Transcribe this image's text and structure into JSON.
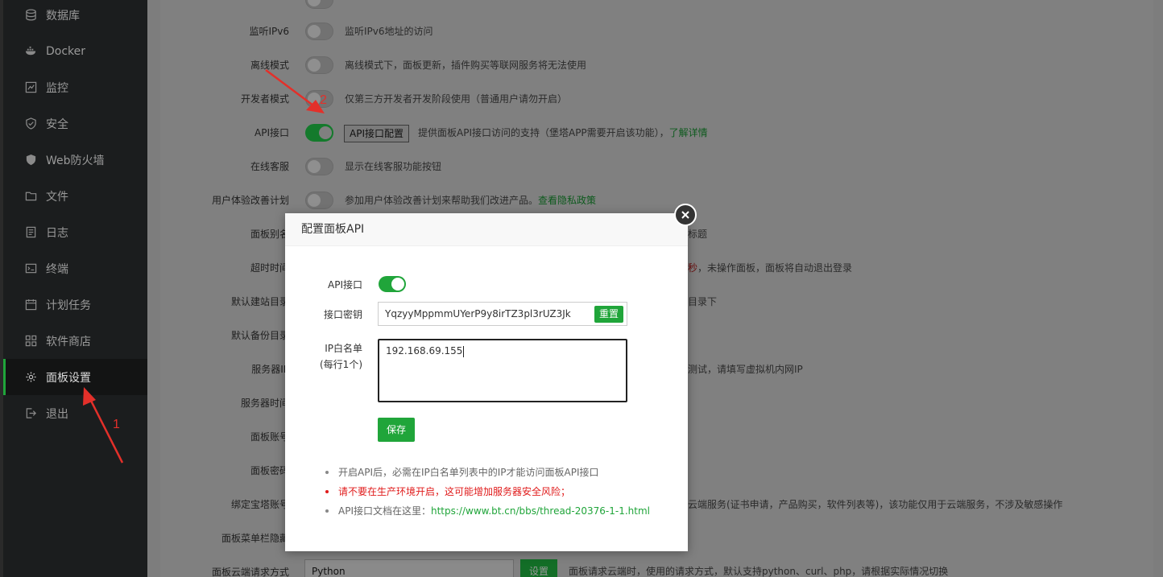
{
  "sidebar": {
    "items": [
      {
        "label": "数据库",
        "icon": "database-icon"
      },
      {
        "label": "Docker",
        "icon": "docker-icon"
      },
      {
        "label": "监控",
        "icon": "monitor-icon"
      },
      {
        "label": "安全",
        "icon": "shield-icon"
      },
      {
        "label": "Web防火墙",
        "icon": "firewall-icon"
      },
      {
        "label": "文件",
        "icon": "folder-icon"
      },
      {
        "label": "日志",
        "icon": "log-icon"
      },
      {
        "label": "终端",
        "icon": "terminal-icon"
      },
      {
        "label": "计划任务",
        "icon": "calendar-icon"
      },
      {
        "label": "软件商店",
        "icon": "grid-icon"
      },
      {
        "label": "面板设置",
        "icon": "gear-icon",
        "active": true
      },
      {
        "label": "退出",
        "icon": "logout-icon"
      }
    ]
  },
  "settings": {
    "ipv6": {
      "label": "监听IPv6",
      "desc": "监听IPv6地址的访问",
      "on": false
    },
    "offline": {
      "label": "离线模式",
      "desc": "离线模式下，面板更新，插件购买等联网服务将无法使用",
      "on": false
    },
    "dev": {
      "label": "开发者模式",
      "desc": "仅第三方开发者开发阶段使用（普通用户请勿开启）",
      "on": false
    },
    "api": {
      "label": "API接口",
      "button": "API接口配置",
      "desc": "提供面板API接口访问的支持（堡塔APP需要开启该功能），",
      "link": "了解详情",
      "on": true
    },
    "service": {
      "label": "在线客服",
      "desc": "显示在线客服功能按钮",
      "on": false
    },
    "ux": {
      "label": "用户体验改善计划",
      "desc": "参加用户体验改善计划来帮助我们改进产品。",
      "link": "查看隐私政策",
      "on": false
    },
    "alias": {
      "label": "面板别名",
      "tail": "标题"
    },
    "timeout": {
      "label": "超时时间",
      "tail_red": "秒",
      "tail": "，未操作面板，面板将自动退出登录"
    },
    "site_dir": {
      "label": "默认建站目录",
      "tail": "目录下"
    },
    "backup_dir": {
      "label": "默认备份目录"
    },
    "server_ip": {
      "label": "服务器IP",
      "tail": "测试，请填写虚拟机内网IP"
    },
    "server_time": {
      "label": "服务器时间"
    },
    "account": {
      "label": "面板账号"
    },
    "password": {
      "label": "面板密码"
    },
    "bind": {
      "label": "绑定宝塔账号",
      "tail": "云端服务(证书申请，产品购买，软件列表等)，该功能仅用于云端服务，不涉及敏感操作"
    },
    "menu_hide": {
      "label": "面板菜单栏隐藏"
    },
    "cloud": {
      "label": "面板云端请求方式",
      "value": "Python",
      "button": "设置",
      "desc": "面板请求云端时，使用的请求方式，默认支持python、curl、php，请根据实际情况切换"
    }
  },
  "annotations": {
    "one": "1",
    "two": "2"
  },
  "dialog": {
    "title": "配置面板API",
    "api_label": "API接口",
    "key_label": "接口密钥",
    "key_value": "YqzyyMppmmUYerP9y8irTZ3pl3rUZ3Jk",
    "reset": "重置",
    "ip_label_1": "IP白名单",
    "ip_label_2": "(每行1个)",
    "ip_value": "192.168.69.155",
    "save": "保存",
    "note1": "开启API后，必需在IP白名单列表中的IP才能访问面板API接口",
    "note2": "请不要在生产环境开启，这可能增加服务器安全风险；",
    "note3_prefix": "API接口文档在这里：",
    "note3_link": "https://www.bt.cn/bbs/thread-20376-1-1.html"
  },
  "colors": {
    "accent": "#20a53a",
    "danger": "#e01b1b",
    "annotation": "#e3302a"
  }
}
